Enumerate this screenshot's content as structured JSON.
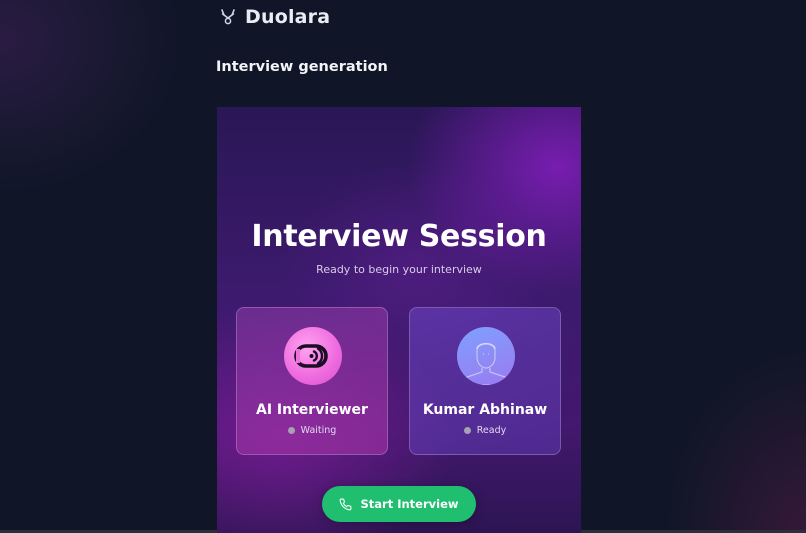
{
  "app": {
    "name": "Duolara",
    "logo_icon": "antler-icon"
  },
  "page": {
    "title": "Interview generation"
  },
  "session": {
    "title": "Interview Session",
    "subtitle": "Ready to begin your interview"
  },
  "participants": [
    {
      "name": "AI Interviewer",
      "status": "Waiting",
      "icon": "ai-voice-icon",
      "avatar_color": "#f06ee0"
    },
    {
      "name": "Kumar Abhinaw",
      "status": "Ready",
      "icon": "user-avatar",
      "avatar_color": "#8a8cf5"
    }
  ],
  "actions": {
    "start_label": "Start Interview",
    "start_icon": "phone-icon",
    "start_color": "#1fbf6f"
  },
  "colors": {
    "background": "#101627",
    "status_dot": "#a7a2b3"
  }
}
